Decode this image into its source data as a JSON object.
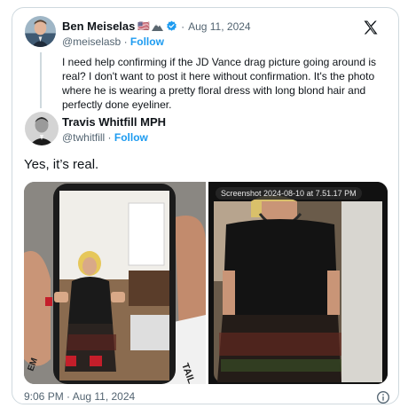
{
  "quoted": {
    "name": "Ben Meiselas",
    "flag_emoji": "🇺🇸",
    "handle": "@meiselasb",
    "follow": "Follow",
    "date": "Aug 11, 2024",
    "separator": "·",
    "text": "I need help confirming if the JD Vance drag picture going around is real? I don't want to post it here without confirmation. It's the photo where he is wearing a pretty floral dress with long blond hair and perfectly done eyeliner."
  },
  "reply": {
    "name": "Travis Whitfill MPH",
    "handle": "@twhitfill",
    "follow": "Follow",
    "separator": "·",
    "text": "Yes, it’s real."
  },
  "media": {
    "screenshot_label": "Screenshot 2024-08-10 at 7.51.17 PM"
  },
  "footer": {
    "timestamp": "9:06 PM · Aug 11, 2024"
  },
  "icons": {
    "x_logo": "x-logo-icon",
    "verified": "verified-badge-icon",
    "info": "info-icon",
    "mountain": "mountain-emoji-icon"
  },
  "colors": {
    "link": "#1d9bf0",
    "muted": "#536471",
    "text": "#0f1419",
    "border": "#cfd9de"
  }
}
